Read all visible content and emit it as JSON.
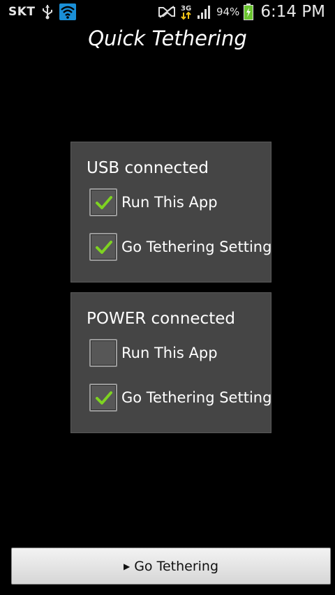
{
  "status_bar": {
    "carrier": "SKT",
    "network": "3G",
    "battery": "94%",
    "time": "6:14 PM",
    "icons": [
      "usb-icon",
      "wifi-icon",
      "mute-icon",
      "network-3g-icon",
      "signal-icon",
      "battery-icon"
    ]
  },
  "app": {
    "title": "Quick Tethering"
  },
  "usb_panel": {
    "title": "USB connected",
    "options": [
      {
        "label": "Run This App",
        "checked": true
      },
      {
        "label": "Go Tethering Setting",
        "checked": true
      }
    ]
  },
  "power_panel": {
    "title": "POWER connected",
    "options": [
      {
        "label": "Run This App",
        "checked": false
      },
      {
        "label": "Go Tethering Setting",
        "checked": true
      }
    ]
  },
  "action_button": {
    "label": "Go Tethering"
  },
  "colors": {
    "check": "#7ed321",
    "panel": "#454545",
    "wifi": "#1a8fd6",
    "battery": "#6ac52f"
  }
}
